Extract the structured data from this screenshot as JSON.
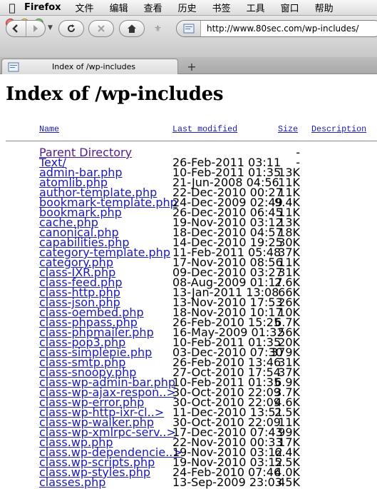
{
  "menubar": {
    "app_name": "Firefox",
    "items": [
      "文件",
      "编辑",
      "查看",
      "历史",
      "书签",
      "工具",
      "窗口",
      "帮助"
    ]
  },
  "toolbar": {
    "url": "http://www.80sec.com/wp-includes/"
  },
  "tab": {
    "title": "Index of /wp-includes",
    "new_tab_label": "+"
  },
  "page": {
    "heading": "Index of /wp-includes",
    "columns": {
      "name": "Name",
      "last_modified": "Last modified",
      "size": "Size",
      "description": "Description"
    },
    "parent": {
      "name": "Parent Directory",
      "size": "-"
    },
    "entries": [
      {
        "name": "Text/",
        "date": "26-Feb-2011 03:11",
        "size": "-"
      },
      {
        "name": "admin-bar.php",
        "date": "10-Feb-2011 01:35",
        "size": "13K"
      },
      {
        "name": "atomlib.php",
        "date": "21-Jun-2008 04:56",
        "size": "11K"
      },
      {
        "name": "author-template.php",
        "date": "22-Dec-2010 00:27",
        "size": "11K"
      },
      {
        "name": "bookmark-template.php",
        "date": "24-Dec-2009 02:49",
        "size": "9.4K"
      },
      {
        "name": "bookmark.php",
        "date": "26-Dec-2010 06:45",
        "size": "11K"
      },
      {
        "name": "cache.php",
        "date": "19-Nov-2010 03:12",
        "size": "13K"
      },
      {
        "name": "canonical.php",
        "date": "18-Dec-2010 04:57",
        "size": "18K"
      },
      {
        "name": "capabilities.php",
        "date": "14-Dec-2010 19:25",
        "size": "30K"
      },
      {
        "name": "category-template.php",
        "date": "11-Feb-2011 05:48",
        "size": "37K"
      },
      {
        "name": "category.php",
        "date": "17-Nov-2010 08:56",
        "size": "11K"
      },
      {
        "name": "class-IXR.php",
        "date": "09-Dec-2010 03:27",
        "size": "31K"
      },
      {
        "name": "class-feed.php",
        "date": "08-Aug-2009 01:17",
        "size": "2.6K"
      },
      {
        "name": "class-http.php",
        "date": "13-Jan-2011 13:08",
        "size": "66K"
      },
      {
        "name": "class-json.php",
        "date": "13-Nov-2010 17:53",
        "size": "26K"
      },
      {
        "name": "class-oembed.php",
        "date": "18-Nov-2010 10:17",
        "size": "10K"
      },
      {
        "name": "class-phpass.php",
        "date": "26-Feb-2010 15:25",
        "size": "6.7K"
      },
      {
        "name": "class-phpmailer.php",
        "date": "16-May-2009 01:32",
        "size": "56K"
      },
      {
        "name": "class-pop3.php",
        "date": "10-Feb-2011 01:35",
        "size": "20K"
      },
      {
        "name": "class-simplepie.php",
        "date": "03-Dec-2010 07:30",
        "size": "379K"
      },
      {
        "name": "class-smtp.php",
        "date": "26-Feb-2010 13:46",
        "size": "31K"
      },
      {
        "name": "class-snoopy.php",
        "date": "27-Oct-2010 17:54",
        "size": "37K"
      },
      {
        "name": "class-wp-admin-bar.php",
        "date": "10-Feb-2011 01:35",
        "size": "6.9K"
      },
      {
        "name": "class-wp-ajax-respon..>",
        "date": "30-Oct-2010 22:09",
        "size": "3.7K"
      },
      {
        "name": "class-wp-error.php",
        "date": "30-Oct-2010 22:09",
        "size": "4.6K"
      },
      {
        "name": "class-wp-http-ixr-cl..>",
        "date": "11-Dec-2010 13:51",
        "size": "2.5K"
      },
      {
        "name": "class-wp-walker.php",
        "date": "30-Oct-2010 22:09",
        "size": "11K"
      },
      {
        "name": "class-wp-xmlrpc-serv..>",
        "date": "17-Dec-2010 07:43",
        "size": "99K"
      },
      {
        "name": "class.wp.php",
        "date": "22-Nov-2010 00:33",
        "size": "17K"
      },
      {
        "name": "class.wp-dependencie..>",
        "date": "19-Nov-2010 03:12",
        "size": "6.4K"
      },
      {
        "name": "class.wp-scripts.php",
        "date": "19-Nov-2010 03:12",
        "size": "5.5K"
      },
      {
        "name": "class.wp-styles.php",
        "date": "24-Feb-2010 07:46",
        "size": "4.0K"
      },
      {
        "name": "classes.php",
        "date": "13-Sep-2009 23:03",
        "size": "45K"
      }
    ]
  }
}
